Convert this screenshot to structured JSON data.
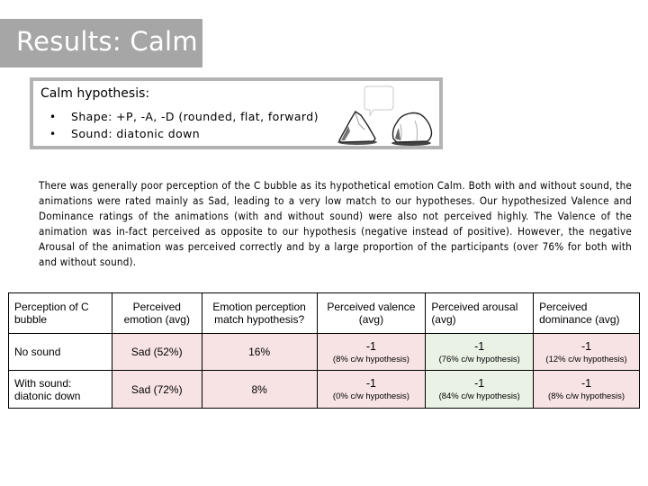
{
  "title": "Results: Calm",
  "hypothesis": {
    "heading": "Calm hypothesis:",
    "items": [
      {
        "bullet": "•",
        "text": "Shape:  +P, -A, -D (rounded, flat, forward)"
      },
      {
        "bullet": "•",
        "text": "Sound:  diatonic down"
      }
    ],
    "illustration_icon": "rock-bubble-characters-illustration"
  },
  "paragraph": "There was generally poor perception of the C bubble as its hypothetical emotion Calm.  Both with and without sound, the animations were rated mainly as Sad, leading to a very low match to our hypotheses.  Our hypothesized Valence and Dominance ratings of the animations (with and without sound) were also not perceived highly.  The Valence of the animation was in-fact perceived as opposite to our hypothesis (negative instead of positive).  However, the negative Arousal of the animation was perceived correctly and by a large proportion of the participants (over 76% for both with and without sound).",
  "table": {
    "headers": [
      "Perception of C bubble",
      "Perceived emotion (avg)",
      "Emotion perception match hypothesis?",
      "Perceived valence (avg)",
      "Perceived arousal (avg)",
      "Perceived dominance (avg)"
    ],
    "rows": [
      {
        "label": "No sound",
        "emotion": "Sad (52%)",
        "match": "16%",
        "valence": {
          "value": "-1",
          "note": "(8% c/w hypothesis)"
        },
        "arousal": {
          "value": "-1",
          "note": "(76% c/w hypothesis)"
        },
        "dominance": {
          "value": "-1",
          "note": "(12% c/w hypothesis)"
        }
      },
      {
        "label": "With sound: diatonic down",
        "emotion": "Sad (72%)",
        "match": "8%",
        "valence": {
          "value": "-1",
          "note": "(0% c/w hypothesis)"
        },
        "arousal": {
          "value": "-1",
          "note": "(84% c/w hypothesis)"
        },
        "dominance": {
          "value": "-1",
          "note": "(8% c/w hypothesis)"
        }
      }
    ]
  },
  "colors": {
    "title_bar": "#a6a6a6",
    "mismatch_cell": "#f8e3e4",
    "match_cell": "#e9f2e4",
    "box_border": "#b3b3b3"
  }
}
